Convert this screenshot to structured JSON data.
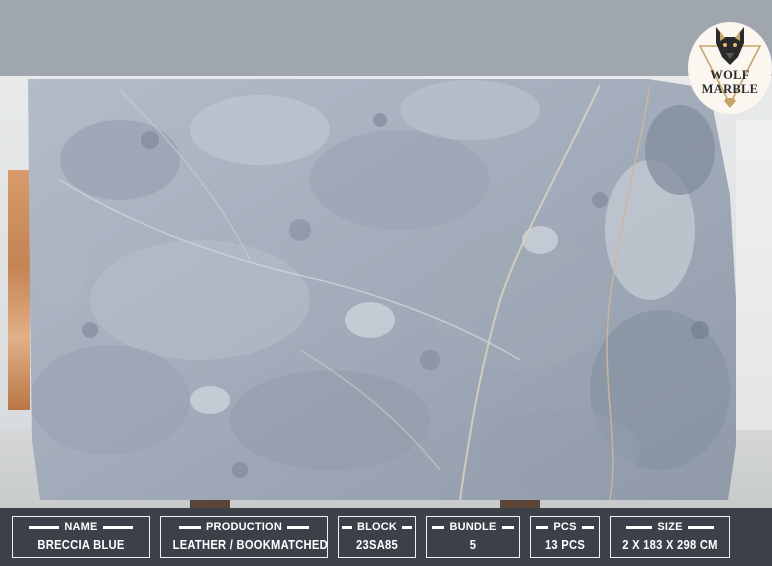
{
  "logo": {
    "brand_line1": "WOLF",
    "brand_line2": "MARBLE",
    "icons": [
      "wolf-icon",
      "triangle-frame-icon",
      "diamond-icon"
    ],
    "accent_color": "#c7a56a"
  },
  "slab": {
    "stone_color": "#a5aebb",
    "vein_color": "#d8cfb8"
  },
  "info_bar": {
    "fields": [
      {
        "label": "NAME",
        "value": "BRECCIA BLUE"
      },
      {
        "label": "PRODUCTION",
        "value": "LEATHER / BOOKMATCHED"
      },
      {
        "label": "BLOCK",
        "value": "23SA85"
      },
      {
        "label": "BUNDLE",
        "value": "5"
      },
      {
        "label": "PCS",
        "value": "13 PCS"
      },
      {
        "label": "SIZE",
        "value": "2 X 183 X 298 CM"
      }
    ],
    "background_color": "#3c4048",
    "text_color": "#ffffff"
  }
}
